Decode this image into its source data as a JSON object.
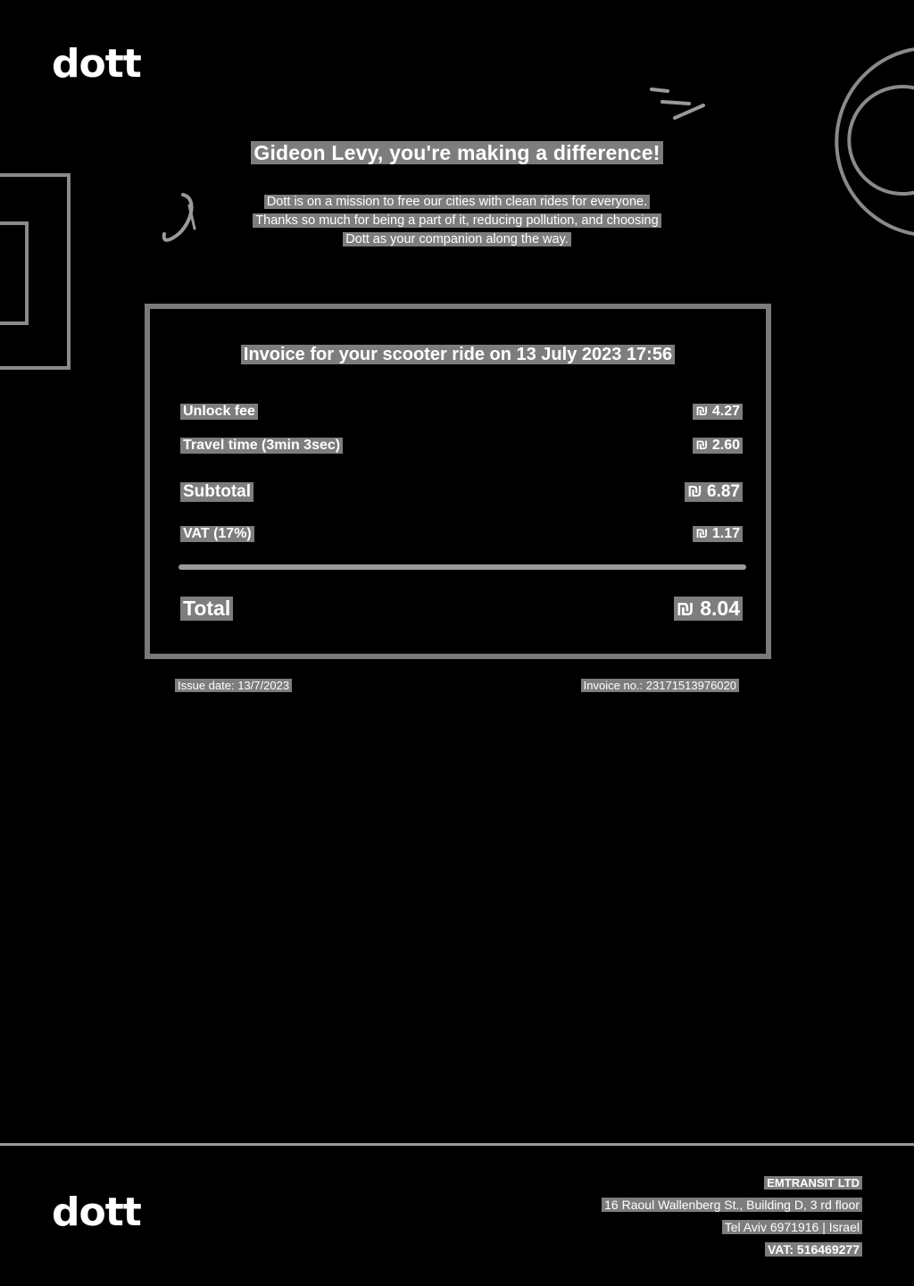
{
  "brand": {
    "logo_text": "dott"
  },
  "header": {
    "headline": "Gideon Levy, you're making a difference!",
    "intro_lines": [
      "Dott is on a mission to free our cities with clean rides for everyone.",
      "Thanks so much for being a part of it, reducing pollution, and choosing",
      "Dott as your companion along the way."
    ]
  },
  "invoice": {
    "title": "Invoice for your scooter ride on 13 July 2023 17:56",
    "lines": [
      {
        "label": "Unlock fee",
        "amount": "₪ 4.27"
      },
      {
        "label": "Travel time (3min 3sec)",
        "amount": "₪ 2.60"
      }
    ],
    "subtotal": {
      "label": "Subtotal",
      "amount": "₪ 6.87"
    },
    "vat": {
      "label": "VAT (17%)",
      "amount": "₪ 1.17"
    },
    "total": {
      "label": "Total",
      "amount": "₪ 8.04"
    },
    "issue_date": "Issue date: 13/7/2023",
    "invoice_no": "Invoice no.: 23171513976020"
  },
  "footer": {
    "company_name": "EMTRANSIT LTD",
    "address": "16 Raoul Wallenberg St., Building D, 3 rd floor",
    "city": "Tel Aviv 6971916 | Israel",
    "vat_number": "VAT: 516469277"
  },
  "colors": {
    "background": "#000000",
    "highlight": "#7d7d7d",
    "border": "#7a7a7a"
  }
}
